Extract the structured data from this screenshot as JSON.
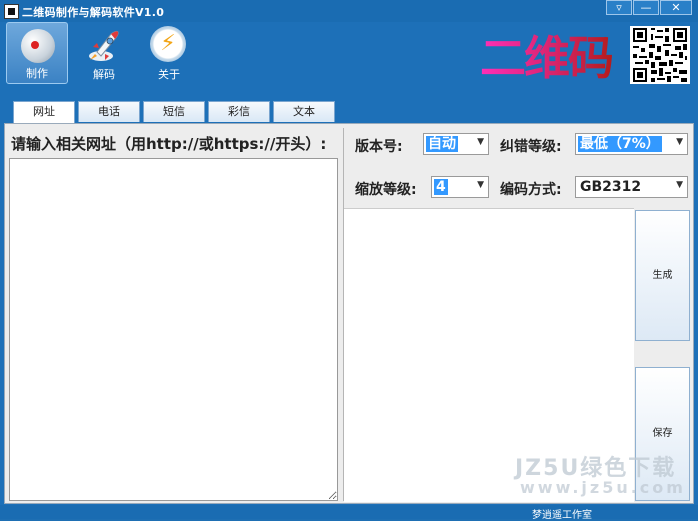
{
  "window": {
    "title": "二维码制作与解码软件V1.0",
    "controls": [
      "▿",
      "—",
      "✕"
    ]
  },
  "toolbar": {
    "items": [
      {
        "label": "制作",
        "icon": "sphere-icon",
        "active": true
      },
      {
        "label": "解码",
        "icon": "rocket-icon",
        "active": false
      },
      {
        "label": "关于",
        "icon": "lightning-icon",
        "active": false
      }
    ],
    "bolt_glyph": "⚡",
    "brand": "二维码"
  },
  "tabs": [
    "网址",
    "电话",
    "短信",
    "彩信",
    "文本"
  ],
  "active_tab": "网址",
  "left": {
    "prompt": "请输入相关网址（用http://或https://开头）:",
    "url_value": ""
  },
  "settings": {
    "version_label": "版本号:",
    "version_value": "自动",
    "ecc_label": "纠错等级:",
    "ecc_value": "最低（7%）",
    "scale_label": "缩放等级:",
    "scale_value": "4",
    "encoding_label": "编码方式:",
    "encoding_value": "GB2312"
  },
  "buttons": {
    "generate": "生成",
    "save": "保存"
  },
  "status": {
    "text": "梦逍遥工作室"
  },
  "watermark": {
    "line1": "JZ5U绿色下载",
    "line2": "www.jz5u.com"
  },
  "colors": {
    "frame": "#1d70b8",
    "selection": "#3399ff",
    "brand_gradient": [
      "#ff2fb8",
      "#b41c1c"
    ]
  }
}
